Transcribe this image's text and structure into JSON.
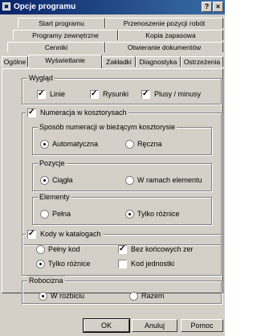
{
  "window": {
    "title": "Opcje programu",
    "help_btn": "?",
    "close_btn": "×"
  },
  "tabs": {
    "row1": [
      "Start programu",
      "Przenoszenie pozycji robót"
    ],
    "row2": [
      "Programy zewnętrzne",
      "Kopia zapasowa"
    ],
    "row3": [
      "Cenniki",
      "Otwieranie dokumentów"
    ],
    "row4": [
      "Ogólne",
      "Wyświetlanie",
      "Zakładki",
      "Diagnostyka",
      "Ostrzeżenia"
    ],
    "active": "Wyświetlanie"
  },
  "wyglad": {
    "label": "Wygląd",
    "options": [
      {
        "label": "Linie",
        "checked": true
      },
      {
        "label": "Rysunki",
        "checked": true
      },
      {
        "label": "Plusy / minusy",
        "checked": true
      }
    ]
  },
  "numeracja": {
    "label": "Numeracja w kosztorysach",
    "checked": true,
    "sposob": {
      "label": "Sposób numeracji w bieżącym kosztorysie",
      "options": [
        "Automatyczna",
        "Ręczna"
      ],
      "selected": "Automatyczna"
    },
    "pozycje": {
      "label": "Pozycje",
      "options": [
        "Ciągła",
        "W ramach elementu"
      ],
      "selected": "Ciągła"
    },
    "elementy": {
      "label": "Elementy",
      "options": [
        "Pełna",
        "Tylko różnice"
      ],
      "selected": "Tylko różnice"
    }
  },
  "kody": {
    "label": "Kody w katalogach",
    "checked": true,
    "radios": [
      "Pełny kod",
      "Tylko różnice"
    ],
    "selected": "Tylko różnice",
    "checks": [
      {
        "label": "Bez końcowych zer",
        "checked": true
      },
      {
        "label": "Kod jednostki",
        "checked": false
      }
    ]
  },
  "robocizna": {
    "label": "Robocizna",
    "options": [
      "W rozbiciu",
      "Razem"
    ],
    "selected": "W rozbiciu"
  },
  "buttons": {
    "ok": "OK",
    "cancel": "Anuluj",
    "help": "Pomoc"
  }
}
